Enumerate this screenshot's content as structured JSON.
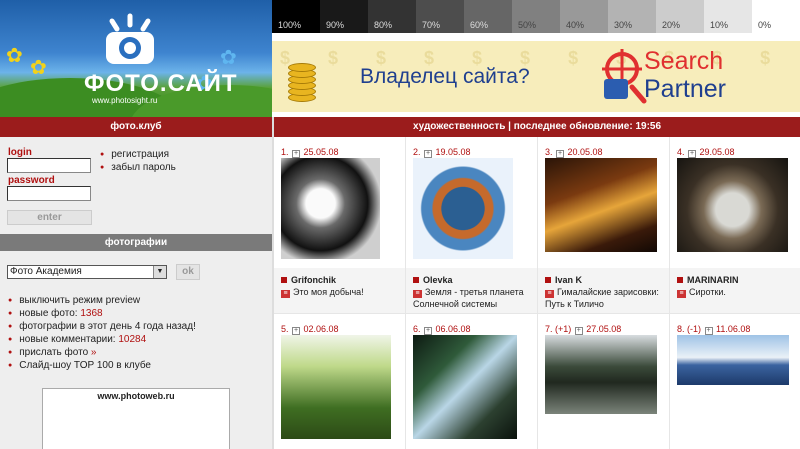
{
  "header": {
    "logo_text": "ФОТО.САЙТ",
    "logo_url": "www.photosight.ru",
    "gray_scale": [
      "100%",
      "90%",
      "80%",
      "70%",
      "60%",
      "50%",
      "40%",
      "30%",
      "20%",
      "10%",
      "0%"
    ],
    "ad": {
      "text": "Владелец сайта?",
      "brand_line1": "Search",
      "brand_line2": "Partner"
    }
  },
  "bars": {
    "left": "фото.клуб",
    "right": "художественность | последнее обновление: 19:56"
  },
  "sidebar": {
    "login_label": "login",
    "password_label": "password",
    "register_link": "регистрация",
    "forgot_link": "забыл пароль",
    "enter_button": "enter",
    "photos_heading": "фотографии",
    "select_value": "Фото Академия",
    "ok_button": "ok",
    "links": [
      {
        "text": "выключить режим preview"
      },
      {
        "text": "новые фото: ",
        "value": "1368"
      },
      {
        "text": "фотографии в этот день 4 года назад!"
      },
      {
        "text": "новые комментарии: ",
        "value": "10284"
      },
      {
        "text": "прислать фото ",
        "value": "»"
      },
      {
        "text": "Слайд-шоу TOP 100 в клубе"
      }
    ],
    "thumb_caption": "www.photoweb.ru"
  },
  "photos": [
    {
      "num": "1.",
      "prefix": "",
      "date": "25.05.08",
      "author": "Grifonchik",
      "title": "Это моя добыча!"
    },
    {
      "num": "2.",
      "prefix": "",
      "date": "19.05.08",
      "author": "Olevka",
      "title": "Земля - третья планета Солнечной системы"
    },
    {
      "num": "3.",
      "prefix": "",
      "date": "20.05.08",
      "author": "Ivan K",
      "title": "Гималайские зарисовки: Путь к Тиличо"
    },
    {
      "num": "4.",
      "prefix": "",
      "date": "29.05.08",
      "author": "MARINARIN",
      "title": "Сиротки."
    },
    {
      "num": "5.",
      "prefix": "",
      "date": "02.06.08"
    },
    {
      "num": "6.",
      "prefix": "",
      "date": "06.06.08"
    },
    {
      "num": "7.",
      "prefix": "(+1)",
      "date": "27.05.08"
    },
    {
      "num": "8.",
      "prefix": "(-1)",
      "date": "11.06.08"
    }
  ],
  "colors": {
    "accent": "#9b1c1c",
    "link_red": "#b01010",
    "sidebar_bg": "#eeeeee"
  }
}
